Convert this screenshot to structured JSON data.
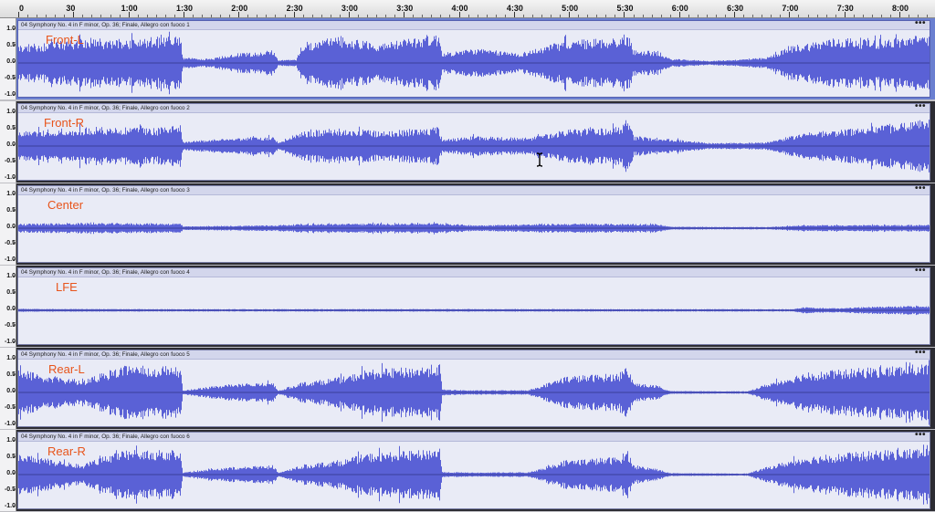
{
  "timeline": {
    "labels": [
      "0",
      "30",
      "1:00",
      "1:30",
      "2:00",
      "2:30",
      "3:00",
      "3:30",
      "4:00",
      "4:30",
      "5:00",
      "5:30",
      "6:00",
      "6:30",
      "7:00",
      "7:30",
      "8:00"
    ]
  },
  "amplitude_labels": [
    "1.0",
    "0.5",
    "0.0",
    "-0.5",
    "-1.0"
  ],
  "tracks": [
    {
      "clip_name": "04 Symphony No. 4 in F minor, Op. 36; Finale, Allegro con fuoco 1",
      "label": "Front-L",
      "selected": true
    },
    {
      "clip_name": "04 Symphony No. 4 in F minor, Op. 36; Finale, Allegro con fuoco 2",
      "label": "Front-R",
      "selected": false
    },
    {
      "clip_name": "04 Symphony No. 4 in F minor, Op. 36; Finale, Allegro con fuoco 3",
      "label": "Center",
      "selected": false
    },
    {
      "clip_name": "04 Symphony No. 4 in F minor, Op. 36; Finale, Allegro con fuoco 4",
      "label": "LFE",
      "selected": false
    },
    {
      "clip_name": "04 Symphony No. 4 in F minor, Op. 36; Finale, Allegro con fuoco 5",
      "label": "Rear-L",
      "selected": false
    },
    {
      "clip_name": "04 Symphony No. 4 in F minor, Op. 36; Finale, Allegro con fuoco 6",
      "label": "Rear-R",
      "selected": false
    }
  ],
  "clip_menu_label": "•••",
  "colors": {
    "waveform": "#5a61d6",
    "label_overlay": "#e8541b",
    "clip_background": "#e9ebf6",
    "selection_border": "#6a7fd0"
  }
}
